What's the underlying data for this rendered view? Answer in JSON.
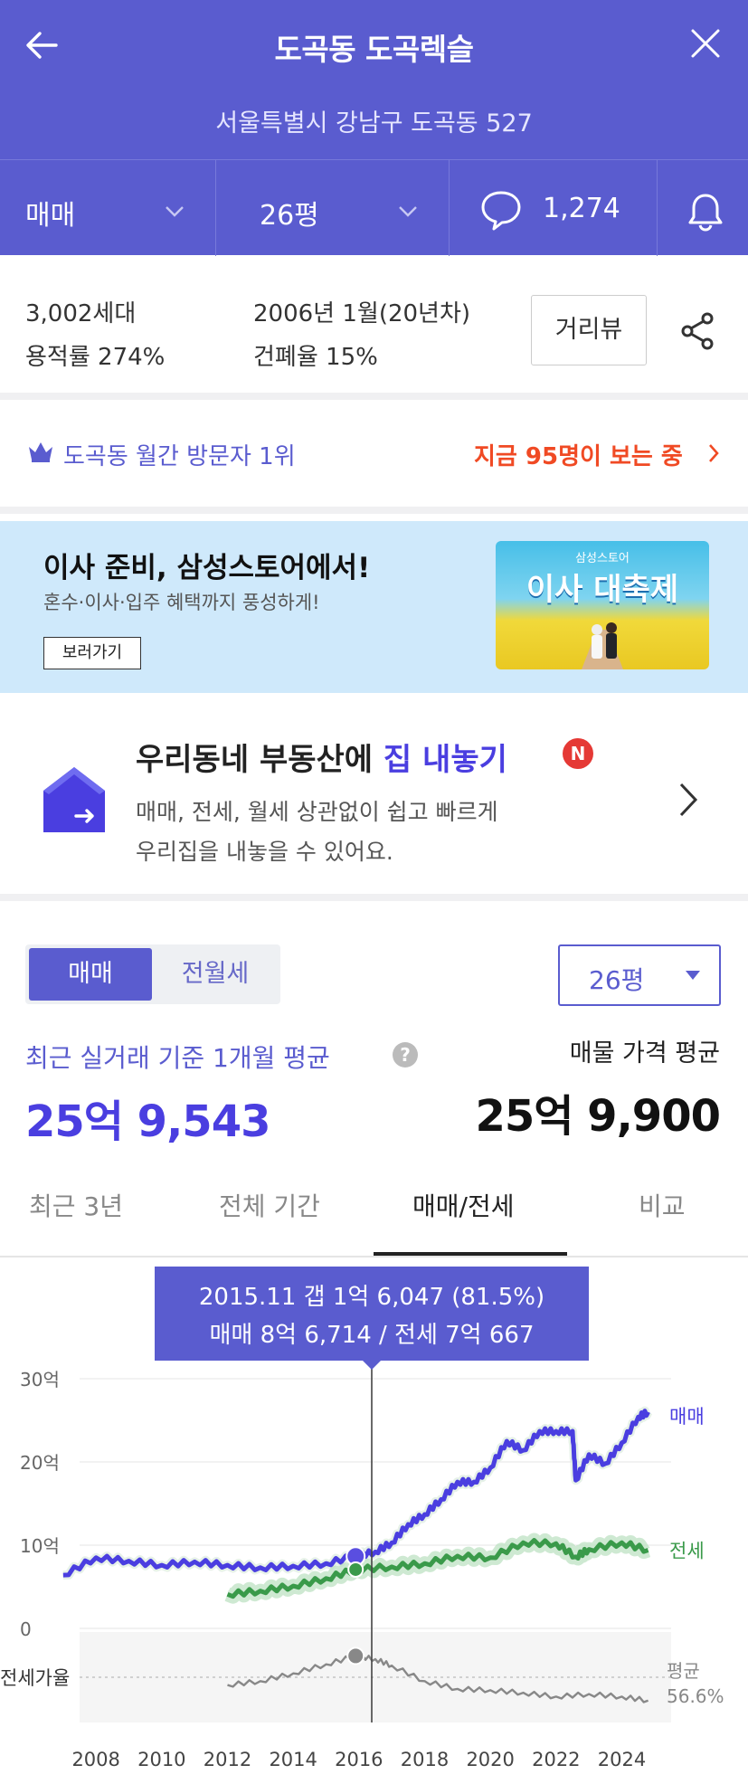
{
  "header": {
    "title": "도곡동 도곡렉슬",
    "address": "서울특별시 강남구 도곡동 527",
    "trade_type": "매매",
    "pyeong": "26평",
    "comment_count": "1,274"
  },
  "info": {
    "households": "3,002세대",
    "far": "용적률 274%",
    "built": "2006년 1월(20년차)",
    "bcr": "건폐율 15%",
    "street_view": "거리뷰"
  },
  "rank": {
    "text": "도곡동 월간 방문자 1위",
    "now": "지금 95명이 보는 중"
  },
  "banner": {
    "headline": "이사 준비, 삼성스토어에서!",
    "sub": "혼수·이사·입주 혜택까지 풍성하게!",
    "cta": "보러가기",
    "img_small": "삼성스토어",
    "img_big": "이사 대축제"
  },
  "sell": {
    "title_a": "우리동네 부동산에 ",
    "title_b": "집 내놓기",
    "badge": "N",
    "desc1": "매매, 전세, 월세 상관없이 쉽고 빠르게",
    "desc2": "우리집을 내놓을 수 있어요."
  },
  "price": {
    "seg_on": "매매",
    "seg_off": "전월세",
    "pyeong": "26평",
    "recent_label": "최근 실거래 기준 1개월 평균",
    "recent_value": "25억 9,543",
    "listing_label": "매물 가격 평균",
    "listing_value": "25억 9,900"
  },
  "tabs": [
    "최근 3년",
    "전체 기간",
    "매매/전세",
    "비교"
  ],
  "chart_data": {
    "type": "line",
    "tooltip_line1": "2015.11  갭 1억 6,047 (81.5%)",
    "tooltip_line2": "매매 8억 6,714 / 전세 7억 667",
    "y_ticks": [
      "30억",
      "20억",
      "10억",
      "0"
    ],
    "x_ticks": [
      "2008",
      "2010",
      "2012",
      "2014",
      "2016",
      "2018",
      "2020",
      "2022",
      "2024"
    ],
    "series": [
      {
        "name": "매매",
        "color": "#4a3ee0",
        "x": [
          2007.0,
          2008.0,
          2009.0,
          2010.0,
          2011.0,
          2012.0,
          2013.0,
          2014.0,
          2015.0,
          2015.9,
          2016.5,
          2017.0,
          2017.5,
          2018.0,
          2018.5,
          2019.0,
          2019.5,
          2020.0,
          2020.5,
          2021.0,
          2021.5,
          2022.0,
          2022.5,
          2022.6,
          2023.0,
          2023.5,
          2024.0,
          2024.5,
          2024.8
        ],
        "values": [
          6.4,
          8.5,
          8.1,
          7.6,
          8.0,
          7.6,
          7.3,
          7.5,
          7.8,
          8.7,
          9.2,
          10.3,
          12.5,
          13.7,
          15.5,
          17.6,
          17.6,
          19.3,
          22.5,
          21.4,
          23.7,
          23.7,
          23.7,
          17.8,
          20.9,
          19.8,
          22.3,
          25.4,
          26.0
        ]
      },
      {
        "name": "전세",
        "color": "#3a9a4a",
        "x": [
          2012.0,
          2013.0,
          2014.0,
          2015.0,
          2015.9,
          2017.0,
          2018.0,
          2019.0,
          2020.0,
          2021.0,
          2022.0,
          2022.6,
          2023.0,
          2024.0,
          2024.8
        ],
        "values": [
          4.1,
          4.5,
          5.1,
          6.0,
          7.07,
          7.4,
          7.8,
          8.7,
          8.5,
          10.3,
          10.2,
          8.6,
          9.5,
          10.3,
          9.4
        ]
      },
      {
        "name": "전세가율",
        "color": "#888888",
        "x": [
          2012.0,
          2013.0,
          2014.0,
          2015.0,
          2015.9,
          2016.5,
          2017.0,
          2018.0,
          2019.0,
          2020.0,
          2021.0,
          2022.0,
          2023.0,
          2024.0,
          2024.8
        ],
        "values": [
          59,
          62,
          68,
          75,
          81.5,
          79,
          74,
          62,
          56,
          55,
          53,
          50,
          52,
          50,
          47
        ]
      }
    ],
    "ratio_label": "전세가율",
    "avg_label": "평균",
    "avg_value": "56.6%",
    "ylim": [
      0,
      30
    ]
  }
}
